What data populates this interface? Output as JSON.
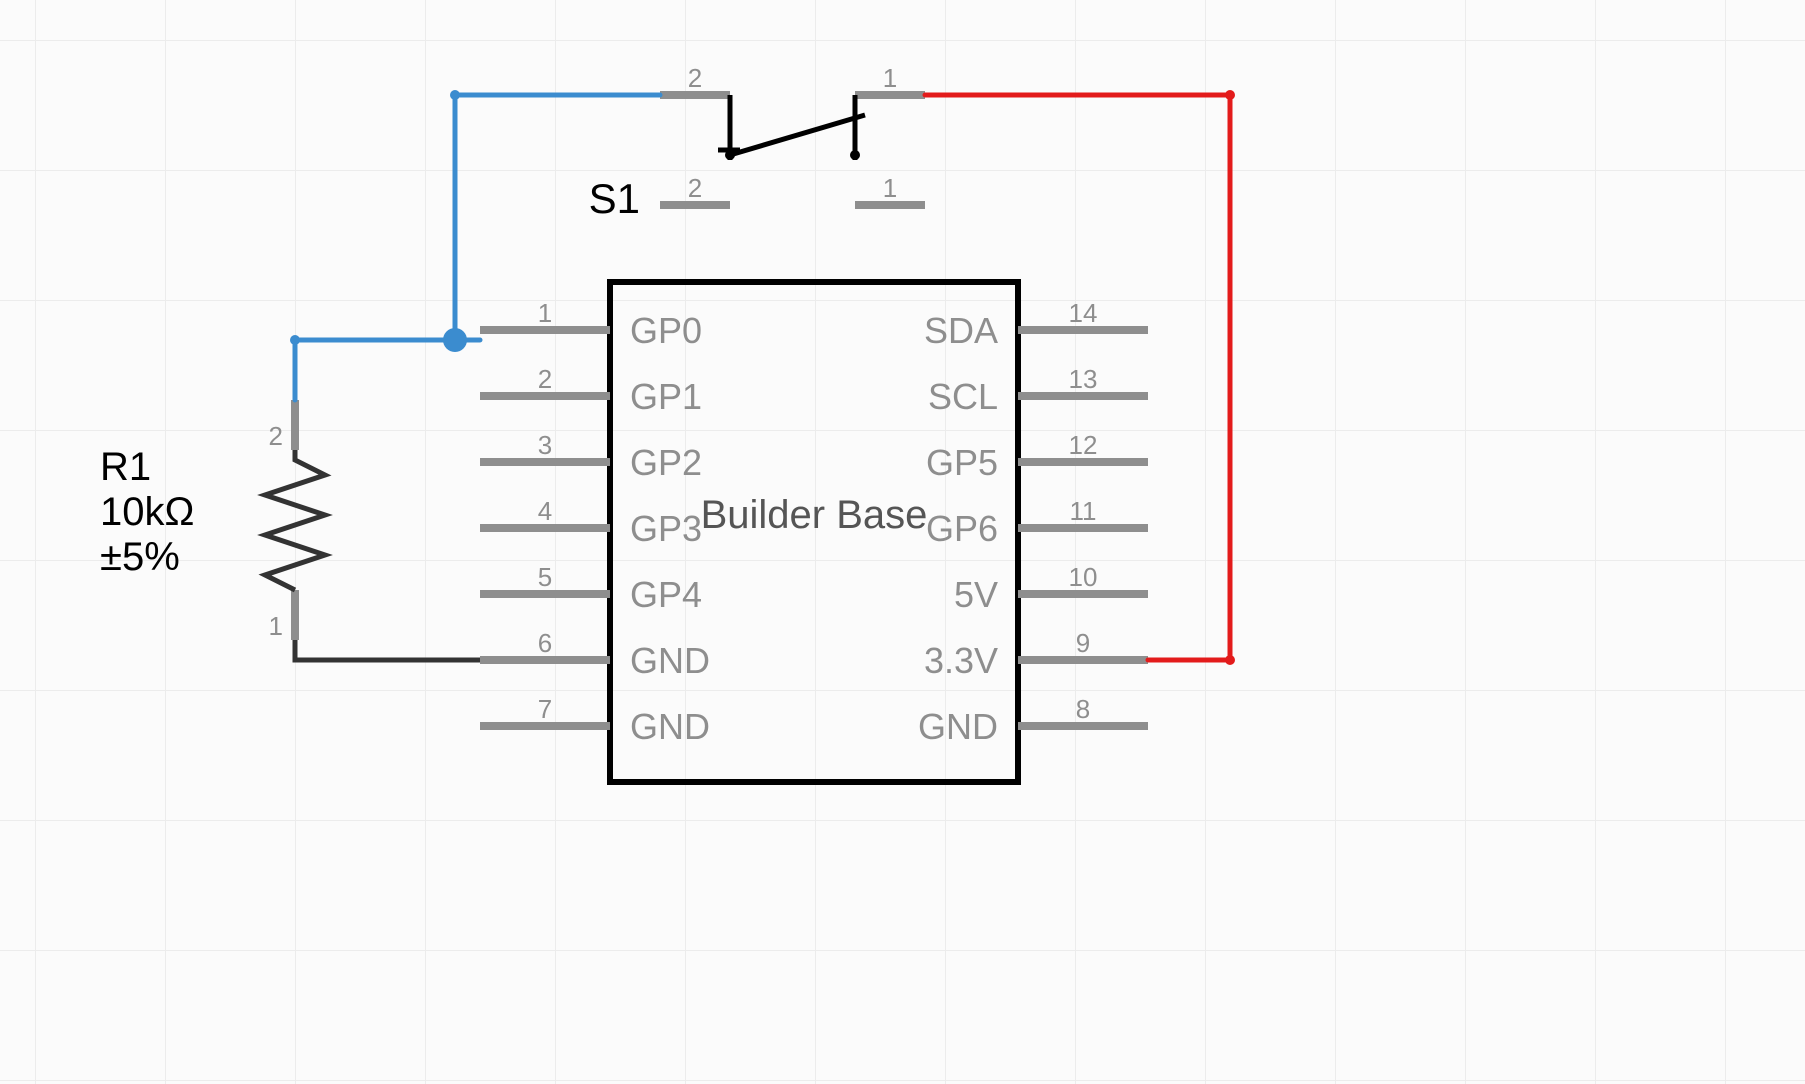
{
  "ic": {
    "name": "Builder Base",
    "left_pins": [
      {
        "num": "1",
        "name": "GP0"
      },
      {
        "num": "2",
        "name": "GP1"
      },
      {
        "num": "3",
        "name": "GP2"
      },
      {
        "num": "4",
        "name": "GP3"
      },
      {
        "num": "5",
        "name": "GP4"
      },
      {
        "num": "6",
        "name": "GND"
      },
      {
        "num": "7",
        "name": "GND"
      }
    ],
    "right_pins": [
      {
        "num": "14",
        "name": "SDA"
      },
      {
        "num": "13",
        "name": "SCL"
      },
      {
        "num": "12",
        "name": "GP5"
      },
      {
        "num": "11",
        "name": "GP6"
      },
      {
        "num": "10",
        "name": "5V"
      },
      {
        "num": "9",
        "name": "3.3V"
      },
      {
        "num": "8",
        "name": "GND"
      }
    ]
  },
  "resistor": {
    "ref": "R1",
    "value": "10kΩ",
    "tol": "±5%",
    "pin_top": "2",
    "pin_bot": "1"
  },
  "switch": {
    "ref": "S1",
    "t_left": "2",
    "t_right": "1",
    "b_left": "2",
    "b_right": "1"
  }
}
